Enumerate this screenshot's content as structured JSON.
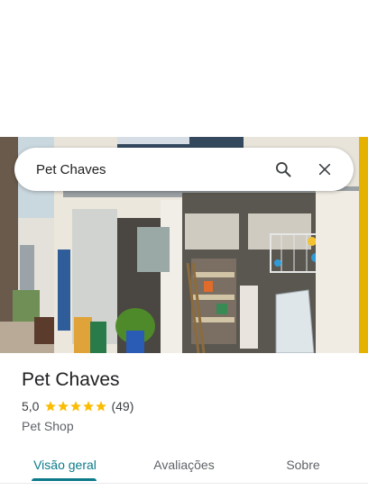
{
  "search": {
    "query": "Pet Chaves"
  },
  "place": {
    "name": "Pet Chaves",
    "rating": "5,0",
    "stars": 5,
    "review_count": "(49)",
    "category": "Pet Shop"
  },
  "tabs": [
    {
      "label": "Visão geral",
      "active": true
    },
    {
      "label": "Avaliações",
      "active": false
    },
    {
      "label": "Sobre",
      "active": false
    }
  ],
  "colors": {
    "accent": "#0b7a8a",
    "star": "#fbbc04",
    "title": "#202124",
    "secondary": "#5f6368"
  },
  "icons": [
    "search-icon",
    "close-icon",
    "star-icon"
  ]
}
